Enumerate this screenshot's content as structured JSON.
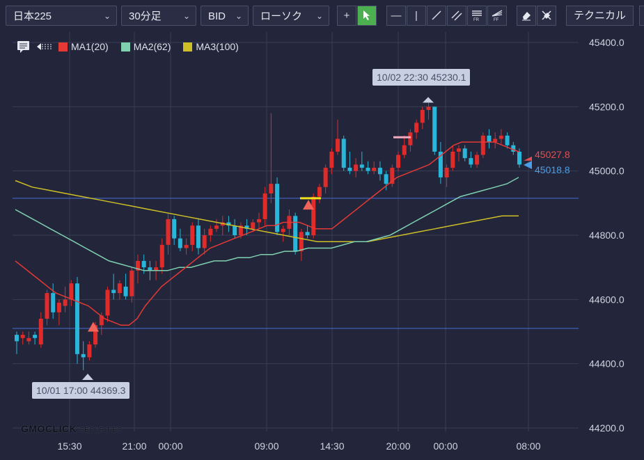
{
  "toolbar": {
    "symbol": "日本225",
    "timeframe": "30分足",
    "price_type": "BID",
    "chart_style": "ローソク",
    "technical_label": "テクニカル",
    "draw_tools": [
      "crosshair-icon",
      "pointer-icon",
      "hline-icon",
      "vline-icon",
      "trendline-icon",
      "channel-icon",
      "fib-retracement-icon",
      "fib-fan-icon",
      "eraser-icon",
      "eraser-all-icon"
    ]
  },
  "legend": [
    {
      "label": "MA1(20)",
      "color": "#e53935"
    },
    {
      "label": "MA2(62)",
      "color": "#7fd1b0"
    },
    {
      "label": "MA3(100)",
      "color": "#cdbf25"
    }
  ],
  "callouts": {
    "high": "10/02 22:30 45230.1",
    "low": "10/01 17:00 44369.3"
  },
  "price_tags": {
    "ask": "45027.8",
    "bid": "45018.8"
  },
  "logo": {
    "main": "GMOCLICK",
    "sub": "SECURITIES"
  },
  "chart_data": {
    "type": "candlestick",
    "yaxis_ticks": [
      "45400.0",
      "45200.0",
      "45000.0",
      "44800.0",
      "44600.0",
      "44400.0",
      "44200.0"
    ],
    "ylim": [
      44200,
      45400
    ],
    "xaxis_ticks": [
      "15:30",
      "21:00",
      "00:00",
      "09:00",
      "14:30",
      "20:00",
      "00:00",
      "08:00"
    ],
    "hlines": [
      44915,
      44510
    ],
    "candles": [
      [
        44490,
        44500,
        44430,
        44470
      ],
      [
        44480,
        44500,
        44460,
        44490
      ],
      [
        44470,
        44500,
        44460,
        44480
      ],
      [
        44490,
        44500,
        44460,
        44480
      ],
      [
        44460,
        44560,
        44450,
        44540
      ],
      [
        44540,
        44630,
        44520,
        44620
      ],
      [
        44620,
        44650,
        44540,
        44560
      ],
      [
        44560,
        44600,
        44520,
        44590
      ],
      [
        44580,
        44640,
        44560,
        44600
      ],
      [
        44600,
        44660,
        44580,
        44650
      ],
      [
        44650,
        44670,
        44400,
        44430
      ],
      [
        44430,
        44470,
        44380,
        44420
      ],
      [
        44420,
        44470,
        44410,
        44460
      ],
      [
        44460,
        44530,
        44450,
        44520
      ],
      [
        44520,
        44560,
        44490,
        44550
      ],
      [
        44550,
        44640,
        44530,
        44630
      ],
      [
        44630,
        44680,
        44600,
        44620
      ],
      [
        44620,
        44660,
        44600,
        44650
      ],
      [
        44640,
        44680,
        44600,
        44610
      ],
      [
        44610,
        44700,
        44590,
        44690
      ],
      [
        44690,
        44740,
        44650,
        44720
      ],
      [
        44720,
        44740,
        44680,
        44700
      ],
      [
        44700,
        44720,
        44660,
        44690
      ],
      [
        44690,
        44720,
        44660,
        44700
      ],
      [
        44700,
        44790,
        44680,
        44770
      ],
      [
        44770,
        44870,
        44740,
        44850
      ],
      [
        44850,
        44860,
        44770,
        44790
      ],
      [
        44790,
        44820,
        44750,
        44760
      ],
      [
        44760,
        44790,
        44740,
        44770
      ],
      [
        44770,
        44840,
        44750,
        44830
      ],
      [
        44830,
        44850,
        44740,
        44760
      ],
      [
        44760,
        44820,
        44740,
        44800
      ],
      [
        44800,
        44830,
        44780,
        44820
      ],
      [
        44820,
        44850,
        44810,
        44830
      ],
      [
        44830,
        44860,
        44800,
        44840
      ],
      [
        44840,
        44860,
        44810,
        44830
      ],
      [
        44830,
        44850,
        44790,
        44800
      ],
      [
        44800,
        44840,
        44790,
        44830
      ],
      [
        44830,
        44850,
        44800,
        44820
      ],
      [
        44820,
        44850,
        44810,
        44840
      ],
      [
        44840,
        44870,
        44820,
        44850
      ],
      [
        44850,
        44950,
        44830,
        44930
      ],
      [
        44930,
        45180,
        44900,
        44960
      ],
      [
        44960,
        44980,
        44800,
        44810
      ],
      [
        44810,
        44830,
        44780,
        44820
      ],
      [
        44820,
        44880,
        44800,
        44860
      ],
      [
        44860,
        44870,
        44740,
        44750
      ],
      [
        44750,
        44820,
        44720,
        44810
      ],
      [
        44810,
        44830,
        44790,
        44800
      ],
      [
        44800,
        44930,
        44790,
        44920
      ],
      [
        44920,
        44960,
        44900,
        44950
      ],
      [
        44950,
        45020,
        44930,
        45010
      ],
      [
        45010,
        45070,
        44990,
        45060
      ],
      [
        45060,
        45160,
        45050,
        45100
      ],
      [
        45100,
        45110,
        45000,
        45010
      ],
      [
        45010,
        45060,
        44990,
        45000
      ],
      [
        45000,
        45040,
        44980,
        45020
      ],
      [
        45020,
        45060,
        45000,
        45010
      ],
      [
        45010,
        45030,
        44990,
        45000
      ],
      [
        45000,
        45030,
        44990,
        45010
      ],
      [
        45010,
        45030,
        44970,
        44990
      ],
      [
        44990,
        45000,
        44940,
        44960
      ],
      [
        44960,
        45020,
        44950,
        45010
      ],
      [
        45010,
        45060,
        45000,
        45050
      ],
      [
        45050,
        45110,
        45040,
        45080
      ],
      [
        45080,
        45130,
        45060,
        45120
      ],
      [
        45120,
        45160,
        45100,
        45150
      ],
      [
        45150,
        45200,
        45130,
        45190
      ],
      [
        45190,
        45230,
        45160,
        45200
      ],
      [
        45200,
        45180,
        45050,
        45060
      ],
      [
        45060,
        45090,
        44960,
        44980
      ],
      [
        44980,
        45020,
        44950,
        45010
      ],
      [
        45010,
        45080,
        45000,
        45060
      ],
      [
        45060,
        45080,
        45030,
        45070
      ],
      [
        45070,
        45080,
        45030,
        45040
      ],
      [
        45040,
        45060,
        45010,
        45020
      ],
      [
        45020,
        45060,
        45010,
        45050
      ],
      [
        45050,
        45120,
        45040,
        45110
      ],
      [
        45110,
        45130,
        45070,
        45090
      ],
      [
        45090,
        45120,
        45070,
        45100
      ],
      [
        45100,
        45130,
        45080,
        45110
      ],
      [
        45110,
        45120,
        45070,
        45080
      ],
      [
        45080,
        45090,
        45050,
        45060
      ],
      [
        45060,
        45070,
        45010,
        45020
      ]
    ],
    "ma1": [
      44720,
      44700,
      44680,
      44660,
      44640,
      44620,
      44610,
      44600,
      44590,
      44580,
      44560,
      44540,
      44530,
      44520,
      44520,
      44540,
      44580,
      44610,
      44640,
      44660,
      44680,
      44700,
      44720,
      44740,
      44760,
      44770,
      44780,
      44790,
      44800,
      44810,
      44820,
      44830,
      44830,
      44840,
      44840,
      44840,
      44830,
      44820,
      44820,
      44820,
      44840,
      44860,
      44880,
      44900,
      44920,
      44940,
      44960,
      44980,
      44990,
      45000,
      45010,
      45020,
      45040,
      45060,
      45080,
      45090,
      45090,
      45090,
      45090,
      45090,
      45080,
      45070,
      45060
    ],
    "ma2": [
      44880,
      44860,
      44840,
      44820,
      44800,
      44780,
      44760,
      44740,
      44720,
      44710,
      44700,
      44690,
      44690,
      44690,
      44700,
      44700,
      44710,
      44720,
      44720,
      44730,
      44730,
      44740,
      44740,
      44750,
      44750,
      44760,
      44760,
      44760,
      44770,
      44780,
      44780,
      44790,
      44800,
      44820,
      44840,
      44860,
      44880,
      44900,
      44920,
      44930,
      44940,
      44950,
      44960,
      44980
    ],
    "ma3": [
      44970,
      44950,
      44940,
      44930,
      44920,
      44910,
      44900,
      44890,
      44880,
      44870,
      44860,
      44850,
      44840,
      44830,
      44820,
      44810,
      44800,
      44790,
      44780,
      44780,
      44780,
      44780,
      44790,
      44800,
      44810,
      44820,
      44830,
      44840,
      44850,
      44860,
      44860
    ]
  }
}
